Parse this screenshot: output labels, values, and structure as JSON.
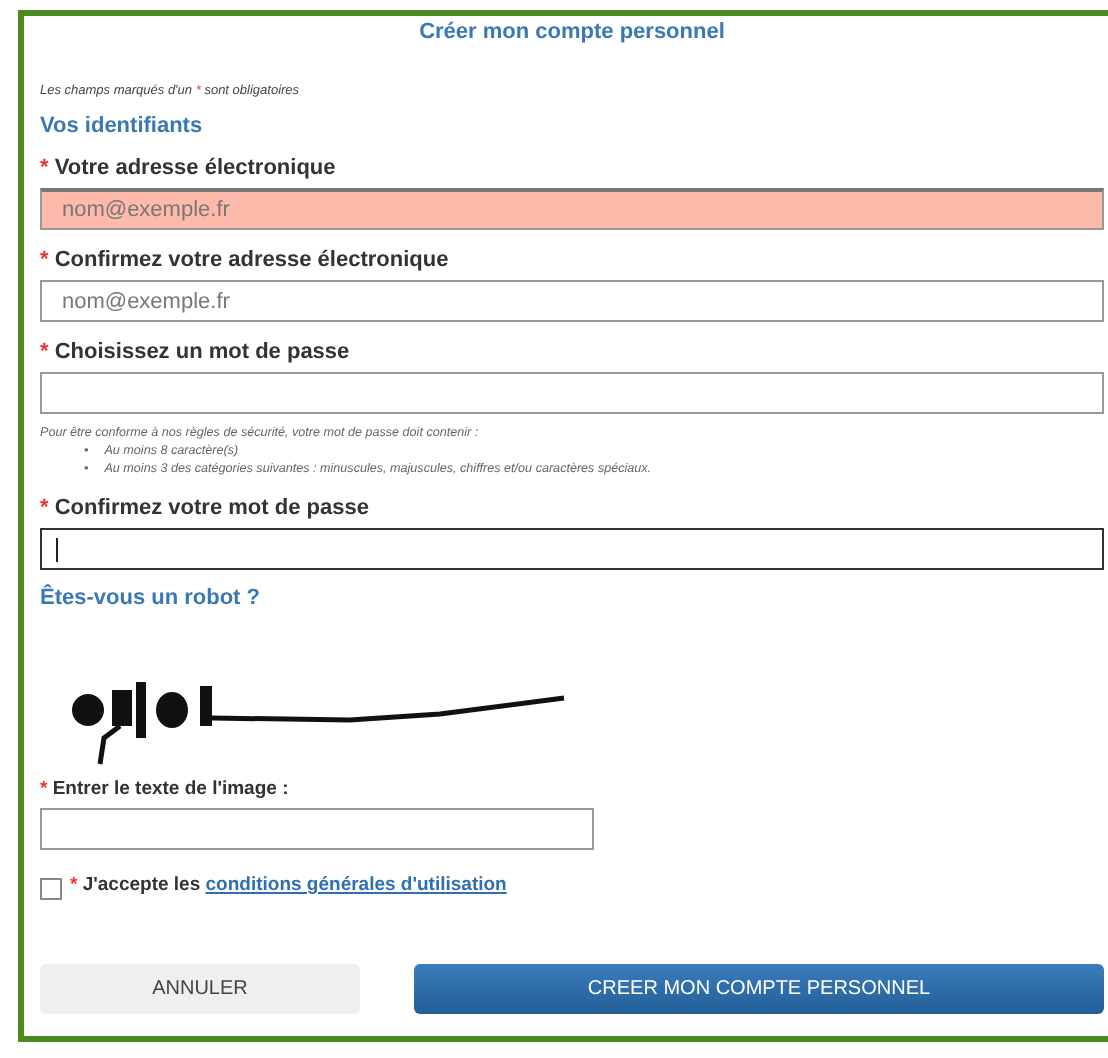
{
  "title": "Créer mon compte personnel",
  "required_note": {
    "before": "Les champs marqués d'un",
    "mark": "*",
    "after": "sont obligatoires"
  },
  "section_identifiers": "Vos identifiants",
  "fields": [
    {
      "mark": "*",
      "label": "Votre adresse électronique",
      "placeholder": "nom@exemple.fr",
      "invalid": true,
      "focused": false
    },
    {
      "mark": "*",
      "label": "Confirmez votre adresse électronique",
      "placeholder": "nom@exemple.fr",
      "invalid": false,
      "focused": false
    },
    {
      "mark": "*",
      "label": "Choisissez un mot de passe",
      "invalid": false,
      "focused": false
    },
    {
      "mark": "*",
      "label": "Confirmez votre mot de passe",
      "invalid": false,
      "focused": true
    }
  ],
  "password_help": {
    "intro": "Pour être conforme à nos règles de sécurité, votre mot de passe doit contenir :",
    "rules": [
      {
        "bullet": "•",
        "text": "Au moins 8 caractère(s)"
      },
      {
        "bullet": "•",
        "text": "Au moins 3 des catégories suivantes : minuscules, majuscules, chiffres et/ou caractères spéciaux."
      }
    ]
  },
  "section_robot": "Êtes-vous un robot ?",
  "captcha": {
    "kind": "picture",
    "mark": "*",
    "label": "Entrer le texte de l'image :"
  },
  "terms": {
    "checked": false,
    "mark": "*",
    "text": "J'accepte les",
    "link": "conditions générales d'utilisation"
  },
  "buttons": [
    {
      "kind": "secondary",
      "label": "ANNULER"
    },
    {
      "kind": "primary",
      "label": "CREER MON COMPTE PERSONNEL"
    }
  ]
}
